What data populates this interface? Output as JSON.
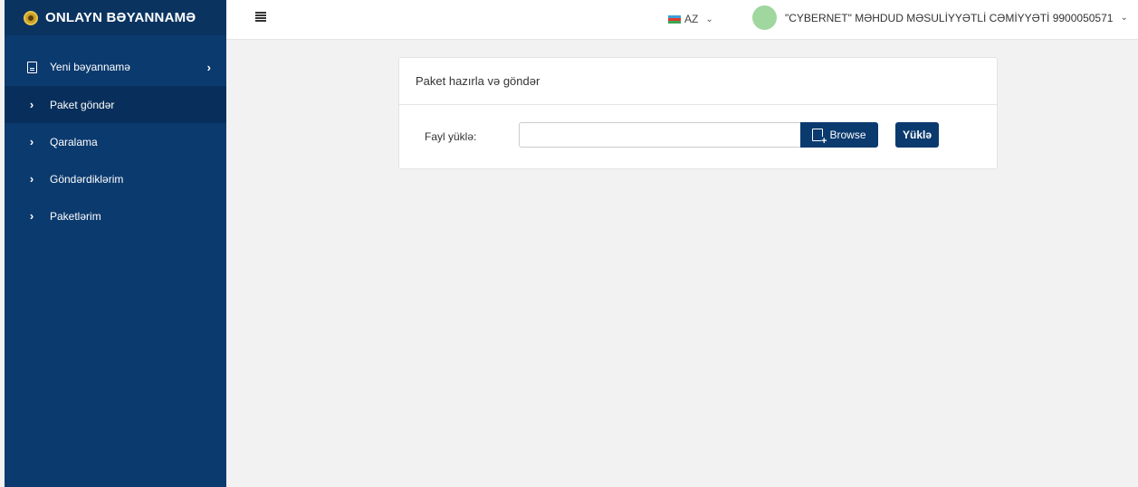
{
  "brand": {
    "title": "ONLAYN BƏYANNAMƏ",
    "logo_icon": "emblem-icon"
  },
  "colors": {
    "sidebar": "#0b3a6e",
    "sidebar_active": "#082f5b",
    "primary_button": "#0b3a6e",
    "avatar": "#9fd79f"
  },
  "sidebar": {
    "items": [
      {
        "label": "Yeni bəyannamə",
        "icon": "document-icon",
        "has_arrow": true
      },
      {
        "label": "Paket göndər",
        "icon": "chevron-right-icon",
        "active": true
      },
      {
        "label": "Qaralama",
        "icon": "chevron-right-icon"
      },
      {
        "label": "Göndərdiklərim",
        "icon": "chevron-right-icon"
      },
      {
        "label": "Paketlərim",
        "icon": "chevron-right-icon"
      }
    ]
  },
  "topbar": {
    "language": "AZ",
    "user_name": "\"CYBERNET\" MƏHDUD MƏSULİYYƏTLİ CƏMİYYƏTİ 9900050571"
  },
  "card": {
    "title": "Paket hazırla və göndər",
    "file_label": "Fayl yüklə:",
    "file_value": "",
    "browse_label": "Browse",
    "upload_label": "Yüklə"
  }
}
